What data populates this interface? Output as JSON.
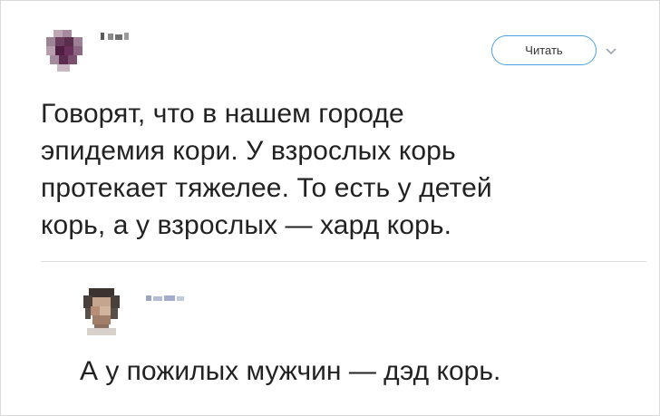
{
  "tweet": {
    "follow_label": "Читать",
    "lines": [
      "Говорят, что в нашем городе",
      "эпидемия кори. У взрослых корь",
      "протекает тяжелее. То есть у детей",
      "корь, а у взрослых — хард корь."
    ]
  },
  "reply": {
    "text": "А у пожилых мужчин — дэд корь."
  },
  "icons": {
    "menu": "chevron-down-icon"
  },
  "colors": {
    "follow_border": "#4aa0e4",
    "divider": "#dcdcdc"
  }
}
